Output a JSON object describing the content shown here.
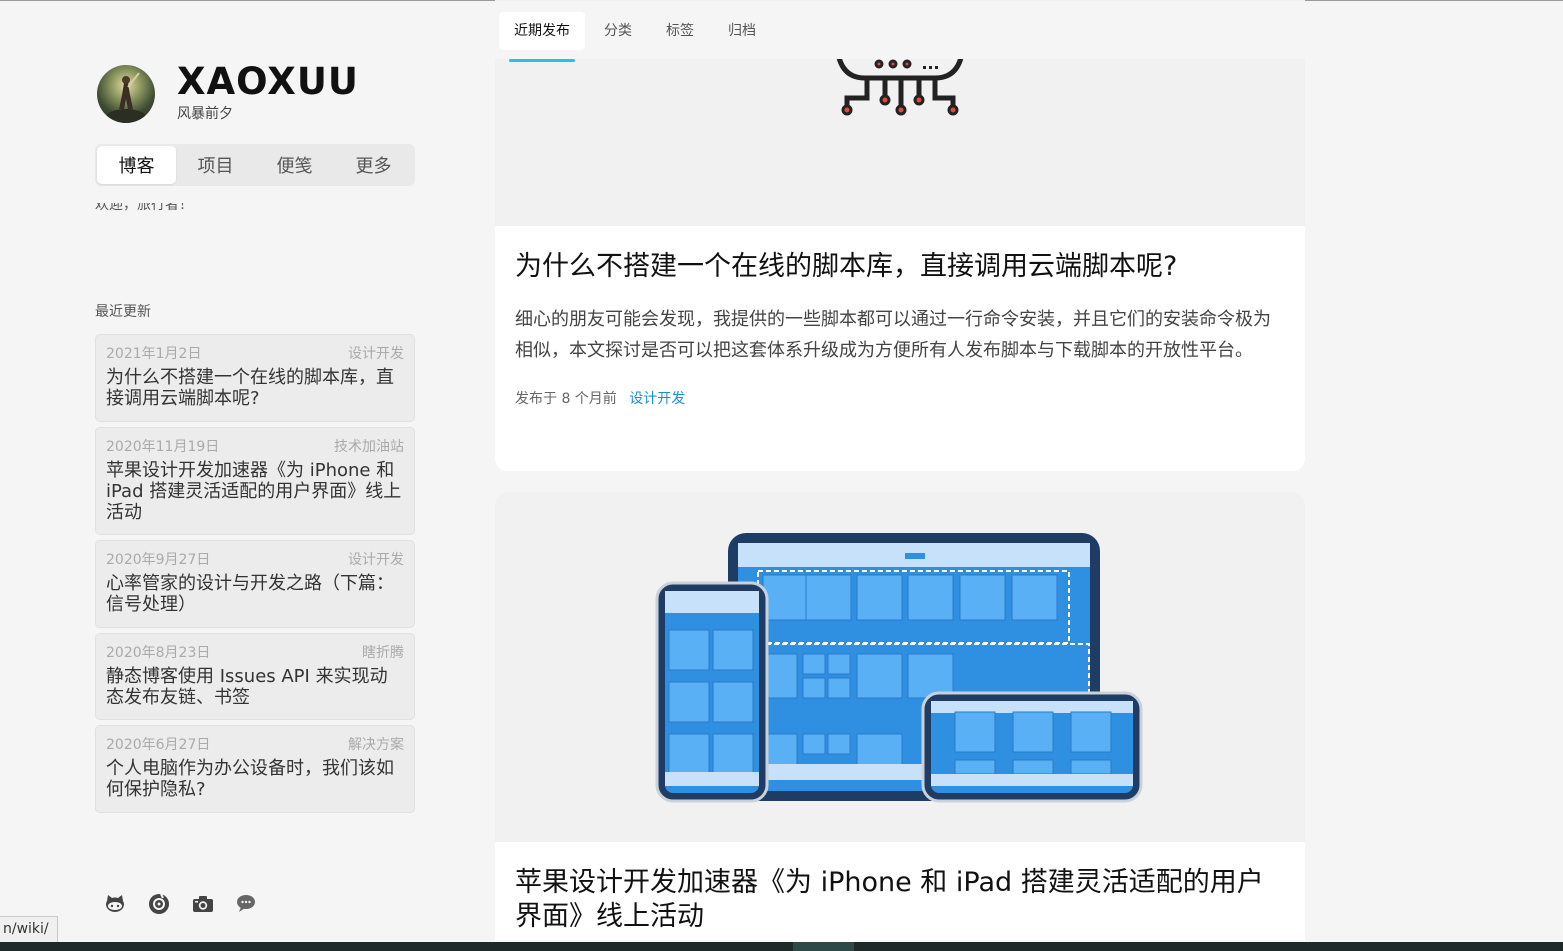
{
  "site": {
    "title": "XAOXUU",
    "subtitle": "风暴前夕"
  },
  "sidebar": {
    "tabs": [
      {
        "label": "博客",
        "active": true
      },
      {
        "label": "项目",
        "active": false
      },
      {
        "label": "便笺",
        "active": false
      },
      {
        "label": "更多",
        "active": false
      }
    ],
    "cut_text": "欢迎，旅行者！",
    "recent_label": "最近更新",
    "updates": [
      {
        "date": "2021年1月2日",
        "category": "设计开发",
        "title": "为什么不搭建一个在线的脚本库，直接调用云端脚本呢?"
      },
      {
        "date": "2020年11月19日",
        "category": "技术加油站",
        "title": "苹果设计开发加速器《为 iPhone 和 iPad 搭建灵活适配的用户界面》线上活动"
      },
      {
        "date": "2020年9月27日",
        "category": "设计开发",
        "title": "心率管家的设计与开发之路（下篇：信号处理）"
      },
      {
        "date": "2020年8月23日",
        "category": "瞎折腾",
        "title": "静态博客使用 Issues API 来实现动态发布友链、书签"
      },
      {
        "date": "2020年6月27日",
        "category": "解决方案",
        "title": "个人电脑作为办公设备时，我们该如何保护隐私?"
      }
    ],
    "social_icons": [
      "github-icon",
      "netease-music-icon",
      "camera-icon",
      "chat-icon"
    ]
  },
  "main": {
    "tabs": [
      {
        "label": "近期发布",
        "active": true
      },
      {
        "label": "分类",
        "active": false
      },
      {
        "label": "标签",
        "active": false
      },
      {
        "label": "归档",
        "active": false
      }
    ],
    "posts": [
      {
        "title": "为什么不搭建一个在线的脚本库，直接调用云端脚本呢?",
        "excerpt": "细心的朋友可能会发现，我提供的一些脚本都可以通过一行命令安装，并且它们的安装命令极为相似，本文探讨是否可以把这套体系升级成为方便所有人发布脚本与下载脚本的开放性平台。",
        "meta": "发布于 8 个月前",
        "category": "设计开发"
      },
      {
        "title": "苹果设计开发加速器《为 iPhone 和 iPad 搭建灵活适配的用户界面》线上活动"
      }
    ]
  },
  "status_url": "n/wiki/",
  "colors": {
    "accent": "#26c0e8",
    "link": "#1a8fd3",
    "background": "#f5f5f5",
    "card": "#ffffff"
  }
}
